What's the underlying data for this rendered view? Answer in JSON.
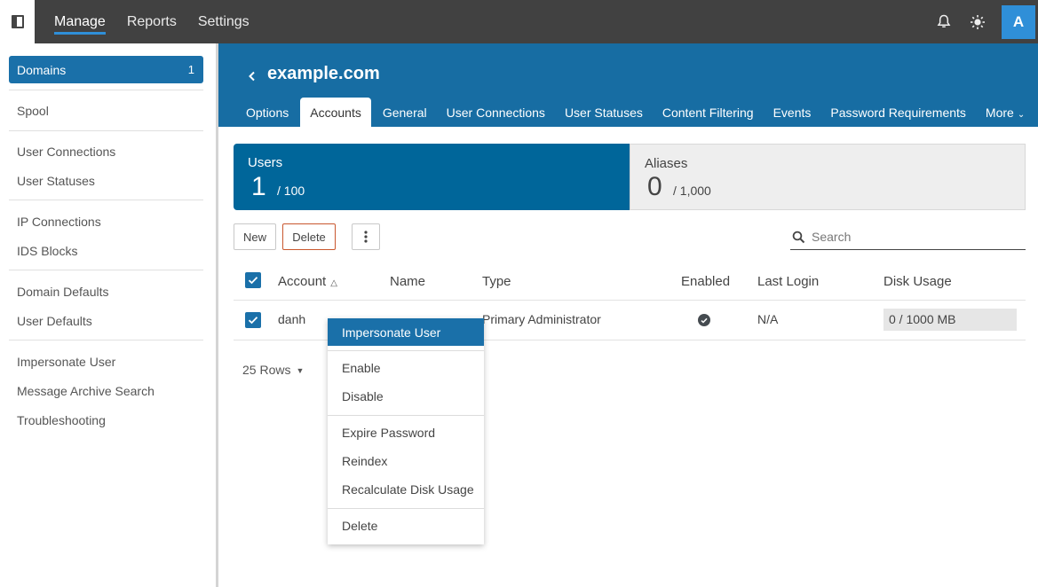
{
  "topbar": {
    "nav": [
      {
        "label": "Manage",
        "active": true
      },
      {
        "label": "Reports",
        "active": false
      },
      {
        "label": "Settings",
        "active": false
      }
    ],
    "icons": [
      "sidebar-toggle-icon",
      "bell-icon",
      "sun-icon"
    ],
    "avatar_initial": "A"
  },
  "sidebar": {
    "domains": {
      "label": "Domains",
      "count": "1"
    },
    "items": [
      {
        "label": "Spool"
      },
      {
        "label": "User Connections"
      },
      {
        "label": "User Statuses"
      },
      {
        "label": "IP Connections"
      },
      {
        "label": "IDS Blocks"
      },
      {
        "label": "Domain Defaults"
      },
      {
        "label": "User Defaults"
      },
      {
        "label": "Impersonate User"
      },
      {
        "label": "Message Archive Search"
      },
      {
        "label": "Troubleshooting"
      }
    ]
  },
  "header": {
    "back_glyph": "‹",
    "title": "example.com",
    "tabs": [
      {
        "label": "Options"
      },
      {
        "label": "Accounts",
        "active": true
      },
      {
        "label": "General"
      },
      {
        "label": "User Connections"
      },
      {
        "label": "User Statuses"
      },
      {
        "label": "Content Filtering"
      },
      {
        "label": "Events"
      },
      {
        "label": "Password Requirements"
      },
      {
        "label": "More"
      }
    ]
  },
  "stats": {
    "users": {
      "label": "Users",
      "count": "1",
      "max": "/ 100"
    },
    "aliases": {
      "label": "Aliases",
      "count": "0",
      "max": "/ 1,000"
    }
  },
  "toolbar": {
    "new_label": "New",
    "delete_label": "Delete",
    "search_placeholder": "Search"
  },
  "table": {
    "headers": {
      "account": "Account",
      "name": "Name",
      "type": "Type",
      "enabled": "Enabled",
      "last_login": "Last Login",
      "disk_usage": "Disk Usage"
    },
    "sort": {
      "column": "account",
      "direction": "ascending"
    },
    "rows": [
      {
        "selected": true,
        "account": "danh",
        "name": "",
        "type": "Primary Administrator",
        "enabled": true,
        "last_login": "N/A",
        "disk_usage": "0 / 1000 MB"
      }
    ],
    "rows_per_page": "25 Rows"
  },
  "context_menu": {
    "items": [
      {
        "label": "Impersonate User",
        "highlighted": true
      },
      {
        "label": "Enable"
      },
      {
        "label": "Disable"
      },
      {
        "label": "Expire Password"
      },
      {
        "label": "Reindex"
      },
      {
        "label": "Recalculate Disk Usage"
      },
      {
        "label": "Delete"
      }
    ]
  },
  "colors": {
    "topbar_bg": "#414141",
    "primary": "#1a70a9",
    "users_card": "#00669a",
    "accent_underline": "#2f8fd8",
    "danger_border": "#c9572e"
  }
}
